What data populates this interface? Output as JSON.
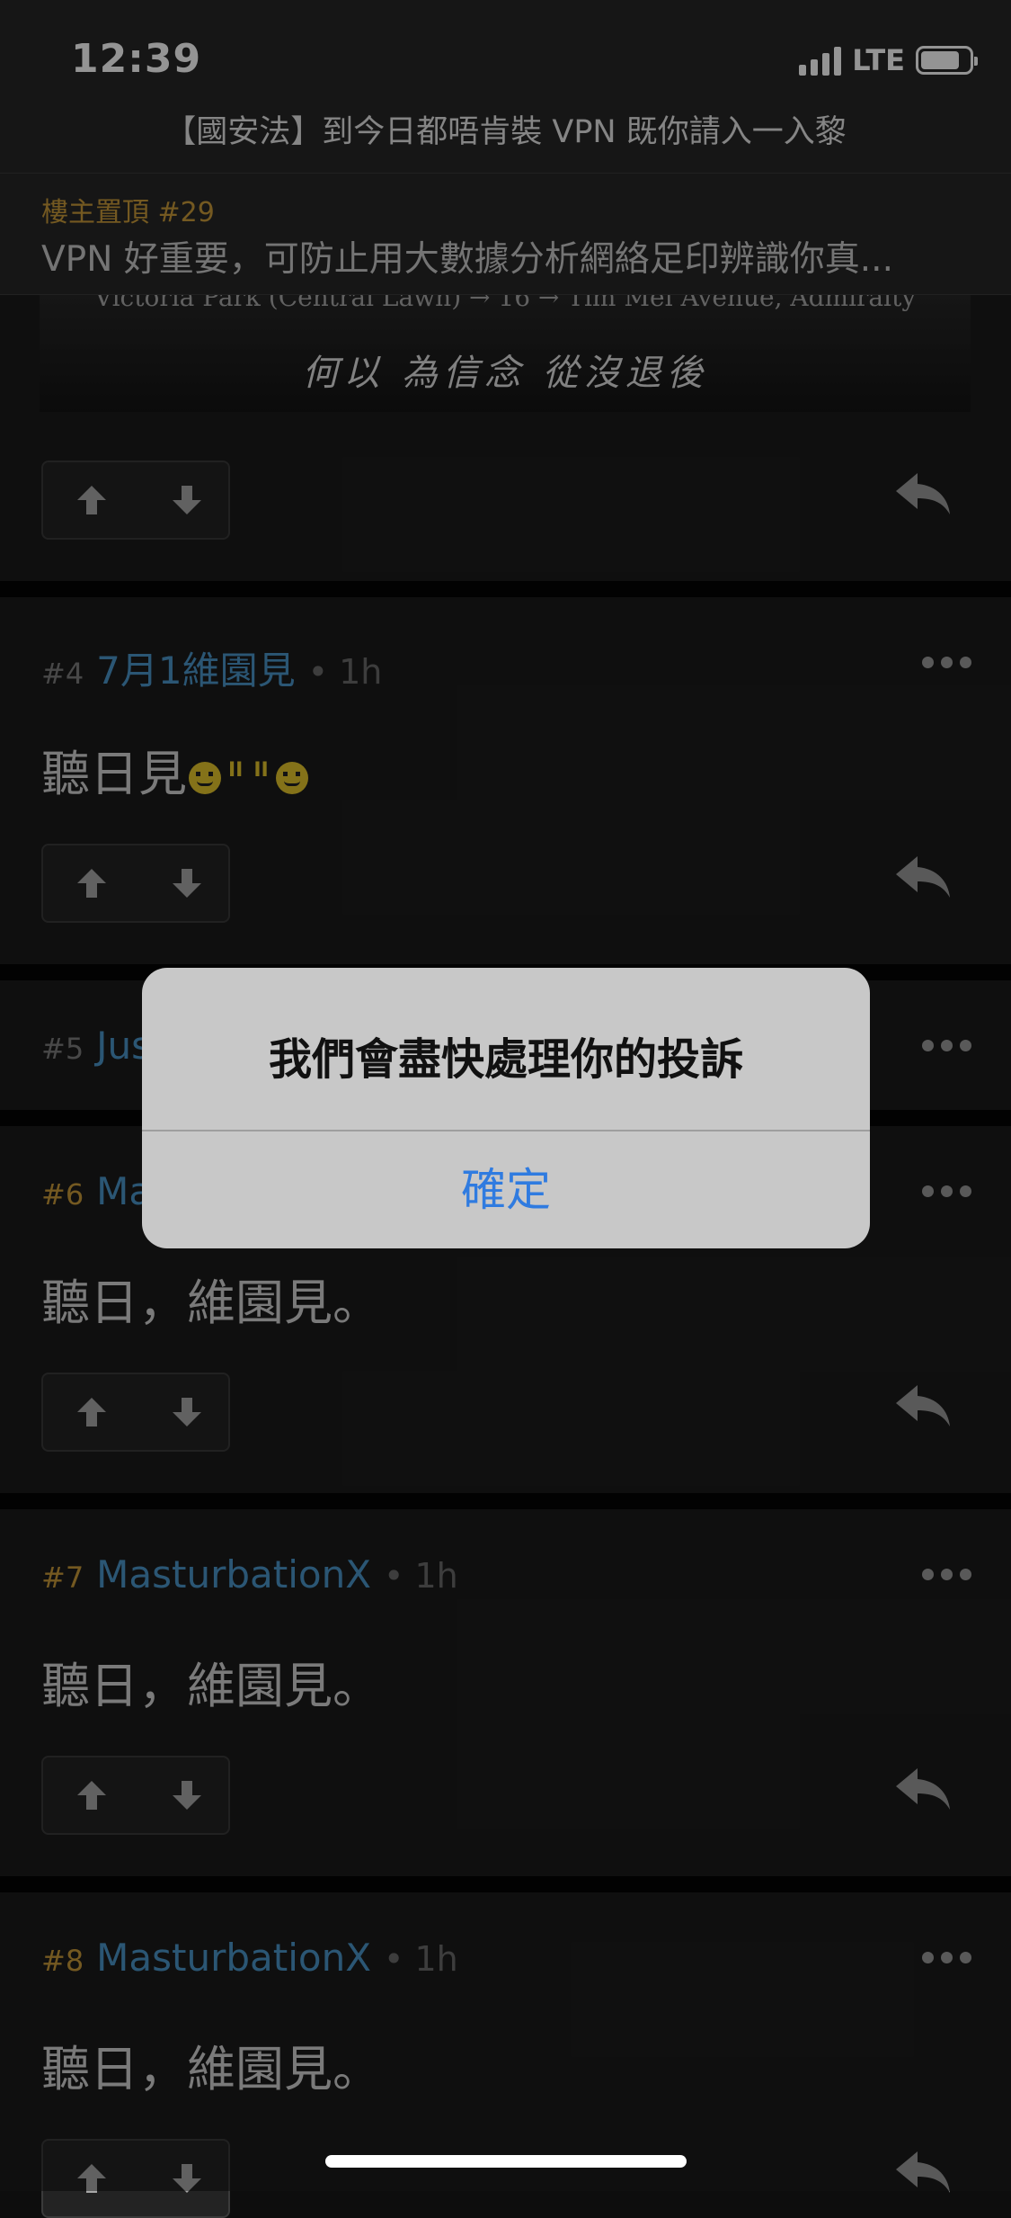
{
  "status": {
    "time": "12:39",
    "network": "LTE"
  },
  "thread": {
    "title": "【國安法】到今日都唔肯裝 VPN 既你請入一入黎",
    "pin_label": "樓主置頂 #29",
    "pin_text": "VPN 好重要，可防止用大數據分析網絡足印辨識你真..."
  },
  "banner": {
    "caption_top": "Victoria Park (Central Lawn) → 16 → Tim Mei Avenue, Admiralty",
    "caption": "何以 為信念 從沒退後"
  },
  "posts": [
    {
      "num": "#4",
      "author": "7月1維園見",
      "time": "• 1h",
      "content": "聽日見"
    },
    {
      "num": "#5",
      "author": "Jus"
    },
    {
      "num": "#6",
      "author": "Ma",
      "content": "聽日，維園見。"
    },
    {
      "num": "#7",
      "author": "MasturbationX",
      "time": "• 1h",
      "content": "聽日，維園見。"
    },
    {
      "num": "#8",
      "author": "MasturbationX",
      "time": "• 1h",
      "content": "聽日，維園見。"
    }
  ],
  "emoji": {
    "ii": "II"
  },
  "dialog": {
    "message": "我們會盡快處理你的投訴",
    "button": "確定"
  },
  "colors": {
    "author": "#4a95c9",
    "gold": "#c99a3a",
    "dialog_button": "#2f7be0"
  }
}
